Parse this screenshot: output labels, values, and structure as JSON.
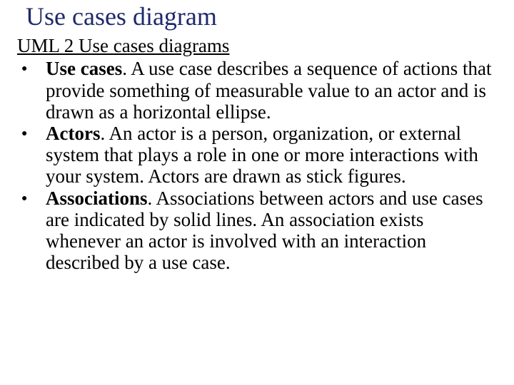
{
  "title": "Use cases diagram",
  "link_text": "UML 2 Use cases diagrams",
  "items": [
    {
      "term": "Use cases",
      "desc": ". A use case describes a sequence of actions that provide something of measurable value to an actor and is drawn as a horizontal ellipse."
    },
    {
      "term": "Actors",
      "desc": ". An actor is a person, organization, or external system that plays a role in one or more interactions with your system. Actors are drawn as stick figures."
    },
    {
      "term": "Associations",
      "desc": ".  Associations between actors and use cases are indicated by solid lines. An association exists whenever an actor is involved with an interaction described by a use case."
    }
  ],
  "bullet_glyph": "●"
}
